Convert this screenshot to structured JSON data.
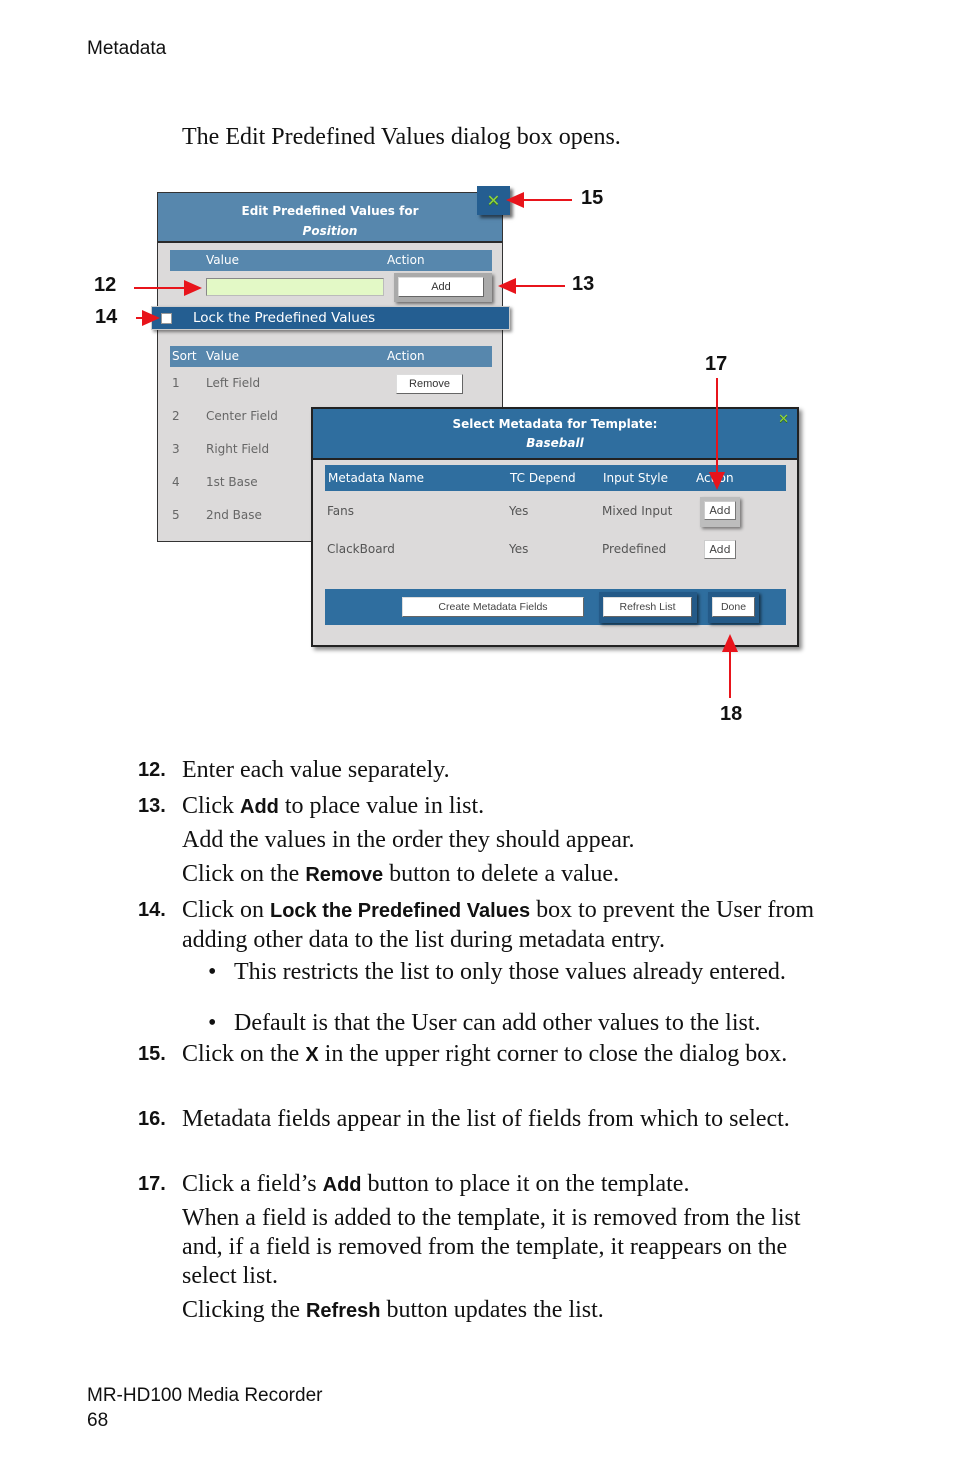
{
  "page_header": "Metadata",
  "intro": "The Edit Predefined Values dialog box opens.",
  "figure": {
    "edit_dialog": {
      "title": "Edit Predefined Values for",
      "subtitle": "Position",
      "close_icon": "x-close-icon",
      "entry_header": {
        "value": "Value",
        "action": "Action"
      },
      "value_input": {
        "value": "",
        "placeholder": ""
      },
      "add_label": "Add",
      "lock_label": "Lock the Predefined Values",
      "lock_checked": false,
      "list_header": {
        "sort": "Sort",
        "value": "Value",
        "action": "Action"
      },
      "rows": [
        {
          "sort": "1",
          "value": "Left Field",
          "action": "Remove"
        },
        {
          "sort": "2",
          "value": "Center Field",
          "action": ""
        },
        {
          "sort": "3",
          "value": "Right Field",
          "action": ""
        },
        {
          "sort": "4",
          "value": "1st Base",
          "action": ""
        },
        {
          "sort": "5",
          "value": "2nd Base",
          "action": ""
        }
      ]
    },
    "select_dialog": {
      "title": "Select Metadata for Template:",
      "subtitle": "Baseball",
      "close_icon": "x-close-icon",
      "columns": [
        "Metadata Name",
        "TC Depend",
        "Input Style",
        "Action"
      ],
      "rows": [
        {
          "name": "Fans",
          "tc": "Yes",
          "style": "Mixed Input",
          "action": "Add"
        },
        {
          "name": "ClackBoard",
          "tc": "Yes",
          "style": "Predefined",
          "action": "Add"
        }
      ],
      "buttons": {
        "create": "Create Metadata Fields",
        "refresh": "Refresh List",
        "done": "Done"
      }
    },
    "callouts": [
      "12",
      "13",
      "14",
      "15",
      "17",
      "18"
    ],
    "callout_color": "#e8141b"
  },
  "steps": {
    "s12": {
      "num": "12.",
      "text": "Enter each value separately."
    },
    "s13": {
      "num": "13.",
      "pre": "Click ",
      "bold": "Add",
      "post": " to place value in list."
    },
    "s13_p1": "Add the values in the order they should appear.",
    "s13_p2": {
      "pre": "Click on the ",
      "bold": "Remove",
      "post": " button to delete a value."
    },
    "s14": {
      "num": "14.",
      "pre": "Click on ",
      "bold": "Lock the Predefined Values",
      "post": " box to prevent the User from adding other data to the list during metadata entry."
    },
    "s14_b1": "This restricts the list to only those values already entered.",
    "s14_b2": "Default is that the User can add other values to the list.",
    "s15": {
      "num": "15.",
      "pre": "Click on the ",
      "bold": "X",
      "post": " in the upper right corner to close the dialog box."
    },
    "s16": {
      "num": "16.",
      "text": "Metadata fields appear in the list of fields from which to select."
    },
    "s17": {
      "num": "17.",
      "pre": "Click a field’s ",
      "bold": "Add",
      "post": " button to place it on the template."
    },
    "s17_p1": "When a field is added to the template, it is removed from the list and, if a field is removed from the template, it reappears on the select list.",
    "s17_p2": {
      "pre": "Clicking the ",
      "bold": "Refresh",
      "post": " button updates the list."
    }
  },
  "footer": {
    "product": "MR-HD100 Media Recorder",
    "page": "68"
  },
  "bullet_glyph": "•"
}
